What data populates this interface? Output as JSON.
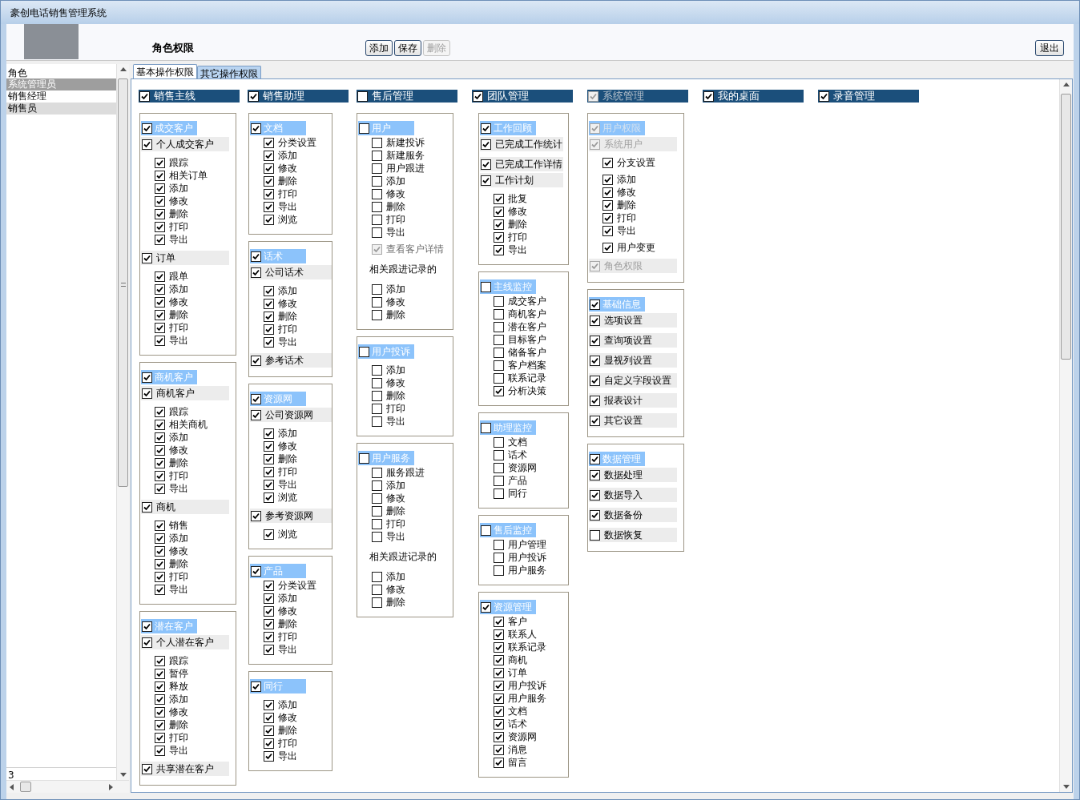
{
  "window": {
    "title": "豪创电话销售管理系统"
  },
  "header": {
    "title": "角色权限",
    "buttons": [
      {
        "label": "添加",
        "disabled": false
      },
      {
        "label": "保存",
        "disabled": false
      },
      {
        "label": "删除",
        "disabled": true
      }
    ],
    "exit_button": "退出"
  },
  "roles": {
    "heading": "角色",
    "items": [
      {
        "label": "系统管理员",
        "selected": true
      },
      {
        "label": "销售经理",
        "selected": false
      },
      {
        "label": "销售员",
        "selected": false
      }
    ],
    "count": "3"
  },
  "tabs": [
    {
      "label": "基本操作权限",
      "selected": true
    },
    {
      "label": "其它操作权限",
      "selected": false
    }
  ],
  "columns": [
    {
      "header": {
        "label": "销售主线",
        "checked": true,
        "disabled": false
      },
      "groups": [
        {
          "blocks": [
            [
              {
                "kind": "title",
                "label": "成交客户",
                "checked": true,
                "disabled": false
              },
              {
                "kind": "section",
                "label": "个人成交客户",
                "checked": true,
                "disabled": false
              }
            ],
            [
              {
                "kind": "option",
                "label": "跟踪",
                "checked": true,
                "disabled": false
              },
              {
                "kind": "option",
                "label": "相关订单",
                "checked": true,
                "disabled": false
              },
              {
                "kind": "option",
                "label": "添加",
                "checked": true,
                "disabled": false
              },
              {
                "kind": "option",
                "label": "修改",
                "checked": true,
                "disabled": false
              },
              {
                "kind": "option",
                "label": "删除",
                "checked": true,
                "disabled": false
              },
              {
                "kind": "option",
                "label": "打印",
                "checked": true,
                "disabled": false
              },
              {
                "kind": "option",
                "label": "导出",
                "checked": true,
                "disabled": false
              }
            ],
            [
              {
                "kind": "section",
                "label": "订单",
                "checked": true,
                "disabled": false
              }
            ],
            [
              {
                "kind": "option",
                "label": "跟单",
                "checked": true,
                "disabled": false
              },
              {
                "kind": "option",
                "label": "添加",
                "checked": true,
                "disabled": false
              },
              {
                "kind": "option",
                "label": "修改",
                "checked": true,
                "disabled": false
              },
              {
                "kind": "option",
                "label": "删除",
                "checked": true,
                "disabled": false
              },
              {
                "kind": "option",
                "label": "打印",
                "checked": true,
                "disabled": false
              },
              {
                "kind": "option",
                "label": "导出",
                "checked": true,
                "disabled": false
              }
            ]
          ]
        },
        {
          "blocks": [
            [
              {
                "kind": "title",
                "label": "商机客户",
                "checked": true,
                "disabled": false
              },
              {
                "kind": "section",
                "label": "商机客户",
                "checked": true,
                "disabled": false
              }
            ],
            [
              {
                "kind": "option",
                "label": "跟踪",
                "checked": true,
                "disabled": false
              },
              {
                "kind": "option",
                "label": "相关商机",
                "checked": true,
                "disabled": false
              },
              {
                "kind": "option",
                "label": "添加",
                "checked": true,
                "disabled": false
              },
              {
                "kind": "option",
                "label": "修改",
                "checked": true,
                "disabled": false
              },
              {
                "kind": "option",
                "label": "删除",
                "checked": true,
                "disabled": false
              },
              {
                "kind": "option",
                "label": "打印",
                "checked": true,
                "disabled": false
              },
              {
                "kind": "option",
                "label": "导出",
                "checked": true,
                "disabled": false
              }
            ],
            [
              {
                "kind": "section",
                "label": "商机",
                "checked": true,
                "disabled": false
              }
            ],
            [
              {
                "kind": "option",
                "label": "销售",
                "checked": true,
                "disabled": false
              },
              {
                "kind": "option",
                "label": "添加",
                "checked": true,
                "disabled": false
              },
              {
                "kind": "option",
                "label": "修改",
                "checked": true,
                "disabled": false
              },
              {
                "kind": "option",
                "label": "删除",
                "checked": true,
                "disabled": false
              },
              {
                "kind": "option",
                "label": "打印",
                "checked": true,
                "disabled": false
              },
              {
                "kind": "option",
                "label": "导出",
                "checked": true,
                "disabled": false
              }
            ]
          ]
        },
        {
          "blocks": [
            [
              {
                "kind": "title",
                "label": "潜在客户",
                "checked": true,
                "disabled": false
              },
              {
                "kind": "section",
                "label": "个人潜在客户",
                "checked": true,
                "disabled": false
              }
            ],
            [
              {
                "kind": "option",
                "label": "跟踪",
                "checked": true,
                "disabled": false
              },
              {
                "kind": "option",
                "label": "暂停",
                "checked": true,
                "disabled": false
              },
              {
                "kind": "option",
                "label": "释放",
                "checked": true,
                "disabled": false
              },
              {
                "kind": "option",
                "label": "添加",
                "checked": true,
                "disabled": false
              },
              {
                "kind": "option",
                "label": "修改",
                "checked": true,
                "disabled": false
              },
              {
                "kind": "option",
                "label": "删除",
                "checked": true,
                "disabled": false
              },
              {
                "kind": "option",
                "label": "打印",
                "checked": true,
                "disabled": false
              },
              {
                "kind": "option",
                "label": "导出",
                "checked": true,
                "disabled": false
              }
            ],
            [
              {
                "kind": "section",
                "label": "共享潜在客户",
                "checked": true,
                "disabled": false
              }
            ]
          ]
        }
      ]
    },
    {
      "header": {
        "label": "销售助理",
        "checked": true,
        "disabled": false
      },
      "groups": [
        {
          "blocks": [
            [
              {
                "kind": "title",
                "label": "文档",
                "checked": true,
                "disabled": false
              },
              {
                "kind": "option",
                "label": "分类设置",
                "checked": true,
                "disabled": false
              },
              {
                "kind": "option",
                "label": "添加",
                "checked": true,
                "disabled": false
              },
              {
                "kind": "option",
                "label": "修改",
                "checked": true,
                "disabled": false
              },
              {
                "kind": "option",
                "label": "删除",
                "checked": true,
                "disabled": false
              },
              {
                "kind": "option",
                "label": "打印",
                "checked": true,
                "disabled": false
              },
              {
                "kind": "option",
                "label": "导出",
                "checked": true,
                "disabled": false
              },
              {
                "kind": "option",
                "label": "浏览",
                "checked": true,
                "disabled": false
              }
            ]
          ]
        },
        {
          "blocks": [
            [
              {
                "kind": "title",
                "label": "话术",
                "checked": true,
                "disabled": false
              },
              {
                "kind": "section",
                "label": "公司话术",
                "checked": true,
                "disabled": false
              }
            ],
            [
              {
                "kind": "option",
                "label": "添加",
                "checked": true,
                "disabled": false
              },
              {
                "kind": "option",
                "label": "修改",
                "checked": true,
                "disabled": false
              },
              {
                "kind": "option",
                "label": "删除",
                "checked": true,
                "disabled": false
              },
              {
                "kind": "option",
                "label": "打印",
                "checked": true,
                "disabled": false
              },
              {
                "kind": "option",
                "label": "导出",
                "checked": true,
                "disabled": false
              }
            ],
            [
              {
                "kind": "section",
                "label": "参考话术",
                "checked": true,
                "disabled": false
              }
            ]
          ]
        },
        {
          "blocks": [
            [
              {
                "kind": "title",
                "label": "资源网",
                "checked": true,
                "disabled": false
              },
              {
                "kind": "section",
                "label": "公司资源网",
                "checked": true,
                "disabled": false
              }
            ],
            [
              {
                "kind": "option",
                "label": "添加",
                "checked": true,
                "disabled": false
              },
              {
                "kind": "option",
                "label": "修改",
                "checked": true,
                "disabled": false
              },
              {
                "kind": "option",
                "label": "删除",
                "checked": true,
                "disabled": false
              },
              {
                "kind": "option",
                "label": "打印",
                "checked": true,
                "disabled": false
              },
              {
                "kind": "option",
                "label": "导出",
                "checked": true,
                "disabled": false
              },
              {
                "kind": "option",
                "label": "浏览",
                "checked": true,
                "disabled": false
              }
            ],
            [
              {
                "kind": "section",
                "label": "参考资源网",
                "checked": true,
                "disabled": false
              }
            ],
            [
              {
                "kind": "option",
                "label": "浏览",
                "checked": true,
                "disabled": false
              }
            ]
          ]
        },
        {
          "blocks": [
            [
              {
                "kind": "title",
                "label": "产品",
                "checked": true,
                "disabled": false
              },
              {
                "kind": "option",
                "label": "分类设置",
                "checked": true,
                "disabled": false
              },
              {
                "kind": "option",
                "label": "添加",
                "checked": true,
                "disabled": false
              },
              {
                "kind": "option",
                "label": "修改",
                "checked": true,
                "disabled": false
              },
              {
                "kind": "option",
                "label": "删除",
                "checked": true,
                "disabled": false
              },
              {
                "kind": "option",
                "label": "打印",
                "checked": true,
                "disabled": false
              },
              {
                "kind": "option",
                "label": "导出",
                "checked": true,
                "disabled": false
              }
            ]
          ]
        },
        {
          "blocks": [
            [
              {
                "kind": "title",
                "label": "同行",
                "checked": true,
                "disabled": false
              }
            ],
            [
              {
                "kind": "option",
                "label": "添加",
                "checked": true,
                "disabled": false
              },
              {
                "kind": "option",
                "label": "修改",
                "checked": true,
                "disabled": false
              },
              {
                "kind": "option",
                "label": "删除",
                "checked": true,
                "disabled": false
              },
              {
                "kind": "option",
                "label": "打印",
                "checked": true,
                "disabled": false
              },
              {
                "kind": "option",
                "label": "导出",
                "checked": true,
                "disabled": false
              }
            ]
          ]
        }
      ]
    },
    {
      "header": {
        "label": "售后管理",
        "checked": false,
        "disabled": false
      },
      "groups": [
        {
          "blocks": [
            [
              {
                "kind": "title",
                "label": "用户",
                "checked": false,
                "disabled": false
              },
              {
                "kind": "option",
                "label": "新建投诉",
                "checked": false,
                "disabled": false
              },
              {
                "kind": "option",
                "label": "新建服务",
                "checked": false,
                "disabled": false
              },
              {
                "kind": "option",
                "label": "用户跟进",
                "checked": false,
                "disabled": false
              },
              {
                "kind": "option",
                "label": "添加",
                "checked": false,
                "disabled": false
              },
              {
                "kind": "option",
                "label": "修改",
                "checked": false,
                "disabled": false
              },
              {
                "kind": "option",
                "label": "删除",
                "checked": false,
                "disabled": false
              },
              {
                "kind": "option",
                "label": "打印",
                "checked": false,
                "disabled": false
              },
              {
                "kind": "option",
                "label": "导出",
                "checked": false,
                "disabled": false
              }
            ],
            [
              {
                "kind": "option",
                "label": "查看客户详情",
                "checked": true,
                "disabled": true
              }
            ],
            [
              {
                "kind": "note",
                "label": "相关跟进记录的"
              }
            ],
            [
              {
                "kind": "option",
                "label": "添加",
                "checked": false,
                "disabled": false
              },
              {
                "kind": "option",
                "label": "修改",
                "checked": false,
                "disabled": false
              },
              {
                "kind": "option",
                "label": "删除",
                "checked": false,
                "disabled": false
              }
            ]
          ]
        },
        {
          "blocks": [
            [
              {
                "kind": "title",
                "label": "用户投诉",
                "checked": false,
                "disabled": false
              }
            ],
            [
              {
                "kind": "option",
                "label": "添加",
                "checked": false,
                "disabled": false
              },
              {
                "kind": "option",
                "label": "修改",
                "checked": false,
                "disabled": false
              },
              {
                "kind": "option",
                "label": "删除",
                "checked": false,
                "disabled": false
              },
              {
                "kind": "option",
                "label": "打印",
                "checked": false,
                "disabled": false
              },
              {
                "kind": "option",
                "label": "导出",
                "checked": false,
                "disabled": false
              }
            ]
          ]
        },
        {
          "blocks": [
            [
              {
                "kind": "title",
                "label": "用户服务",
                "checked": false,
                "disabled": false
              },
              {
                "kind": "option",
                "label": "服务跟进",
                "checked": false,
                "disabled": false
              },
              {
                "kind": "option",
                "label": "添加",
                "checked": false,
                "disabled": false
              },
              {
                "kind": "option",
                "label": "修改",
                "checked": false,
                "disabled": false
              },
              {
                "kind": "option",
                "label": "删除",
                "checked": false,
                "disabled": false
              },
              {
                "kind": "option",
                "label": "打印",
                "checked": false,
                "disabled": false
              },
              {
                "kind": "option",
                "label": "导出",
                "checked": false,
                "disabled": false
              }
            ],
            [
              {
                "kind": "note",
                "label": "相关跟进记录的"
              }
            ],
            [
              {
                "kind": "option",
                "label": "添加",
                "checked": false,
                "disabled": false
              },
              {
                "kind": "option",
                "label": "修改",
                "checked": false,
                "disabled": false
              },
              {
                "kind": "option",
                "label": "删除",
                "checked": false,
                "disabled": false
              }
            ]
          ]
        }
      ]
    },
    {
      "header": {
        "label": "团队管理",
        "checked": true,
        "disabled": false
      },
      "groups": [
        {
          "blocks": [
            [
              {
                "kind": "title",
                "label": "工作回顾",
                "checked": true,
                "disabled": false
              },
              {
                "kind": "section",
                "label": "已完成工作统计",
                "checked": true,
                "disabled": false
              }
            ],
            [
              {
                "kind": "section",
                "label": "已完成工作详情",
                "checked": true,
                "disabled": false
              },
              {
                "kind": "section",
                "label": "工作计划",
                "checked": true,
                "disabled": false
              }
            ],
            [
              {
                "kind": "option",
                "label": "批复",
                "checked": true,
                "disabled": false
              },
              {
                "kind": "option",
                "label": "修改",
                "checked": true,
                "disabled": false
              },
              {
                "kind": "option",
                "label": "删除",
                "checked": true,
                "disabled": false
              },
              {
                "kind": "option",
                "label": "打印",
                "checked": true,
                "disabled": false
              },
              {
                "kind": "option",
                "label": "导出",
                "checked": true,
                "disabled": false
              }
            ]
          ]
        },
        {
          "blocks": [
            [
              {
                "kind": "title",
                "label": "主线监控",
                "checked": false,
                "disabled": false
              },
              {
                "kind": "option",
                "label": "成交客户",
                "checked": false,
                "disabled": false
              },
              {
                "kind": "option",
                "label": "商机客户",
                "checked": false,
                "disabled": false
              },
              {
                "kind": "option",
                "label": "潜在客户",
                "checked": false,
                "disabled": false
              },
              {
                "kind": "option",
                "label": "目标客户",
                "checked": false,
                "disabled": false
              },
              {
                "kind": "option",
                "label": "储备客户",
                "checked": false,
                "disabled": false
              },
              {
                "kind": "option",
                "label": "客户档案",
                "checked": false,
                "disabled": false
              },
              {
                "kind": "option",
                "label": "联系记录",
                "checked": false,
                "disabled": false
              },
              {
                "kind": "option",
                "label": "分析决策",
                "checked": true,
                "disabled": false
              }
            ]
          ]
        },
        {
          "blocks": [
            [
              {
                "kind": "title",
                "label": "助理监控",
                "checked": false,
                "disabled": false
              },
              {
                "kind": "option",
                "label": "文档",
                "checked": false,
                "disabled": false
              },
              {
                "kind": "option",
                "label": "话术",
                "checked": false,
                "disabled": false
              },
              {
                "kind": "option",
                "label": "资源网",
                "checked": false,
                "disabled": false
              },
              {
                "kind": "option",
                "label": "产品",
                "checked": false,
                "disabled": false
              },
              {
                "kind": "option",
                "label": "同行",
                "checked": false,
                "disabled": false
              }
            ]
          ]
        },
        {
          "blocks": [
            [
              {
                "kind": "title",
                "label": "售后监控",
                "checked": false,
                "disabled": false
              },
              {
                "kind": "option",
                "label": "用户管理",
                "checked": false,
                "disabled": false
              },
              {
                "kind": "option",
                "label": "用户投诉",
                "checked": false,
                "disabled": false
              },
              {
                "kind": "option",
                "label": "用户服务",
                "checked": false,
                "disabled": false
              }
            ]
          ]
        },
        {
          "blocks": [
            [
              {
                "kind": "title",
                "label": "资源管理",
                "checked": true,
                "disabled": false
              },
              {
                "kind": "option",
                "label": "客户",
                "checked": true,
                "disabled": false
              },
              {
                "kind": "option",
                "label": "联系人",
                "checked": true,
                "disabled": false
              },
              {
                "kind": "option",
                "label": "联系记录",
                "checked": true,
                "disabled": false
              },
              {
                "kind": "option",
                "label": "商机",
                "checked": true,
                "disabled": false
              },
              {
                "kind": "option",
                "label": "订单",
                "checked": true,
                "disabled": false
              },
              {
                "kind": "option",
                "label": "用户投诉",
                "checked": true,
                "disabled": false
              },
              {
                "kind": "option",
                "label": "用户服务",
                "checked": true,
                "disabled": false
              },
              {
                "kind": "option",
                "label": "文档",
                "checked": true,
                "disabled": false
              },
              {
                "kind": "option",
                "label": "话术",
                "checked": true,
                "disabled": false
              },
              {
                "kind": "option",
                "label": "资源网",
                "checked": true,
                "disabled": false
              },
              {
                "kind": "option",
                "label": "消息",
                "checked": true,
                "disabled": false
              },
              {
                "kind": "option",
                "label": "留言",
                "checked": true,
                "disabled": false
              }
            ]
          ]
        }
      ]
    },
    {
      "header": {
        "label": "系统管理",
        "checked": true,
        "disabled": true
      },
      "groups": [
        {
          "blocks": [
            [
              {
                "kind": "title",
                "label": "用户权限",
                "checked": true,
                "disabled": true
              },
              {
                "kind": "section",
                "label": "系统用户",
                "checked": true,
                "disabled": true
              }
            ],
            [
              {
                "kind": "option",
                "label": "分支设置",
                "checked": true,
                "disabled": false
              }
            ],
            [
              {
                "kind": "option",
                "label": "添加",
                "checked": true,
                "disabled": false
              },
              {
                "kind": "option",
                "label": "修改",
                "checked": true,
                "disabled": false
              },
              {
                "kind": "option",
                "label": "删除",
                "checked": true,
                "disabled": false
              },
              {
                "kind": "option",
                "label": "打印",
                "checked": true,
                "disabled": false
              },
              {
                "kind": "option",
                "label": "导出",
                "checked": true,
                "disabled": false
              }
            ],
            [
              {
                "kind": "option",
                "label": "用户变更",
                "checked": true,
                "disabled": false
              }
            ],
            [
              {
                "kind": "section",
                "label": "角色权限",
                "checked": true,
                "disabled": true
              }
            ]
          ]
        },
        {
          "blocks": [
            [
              {
                "kind": "title",
                "label": "基础信息",
                "checked": true,
                "disabled": false
              },
              {
                "kind": "section",
                "label": "选项设置",
                "checked": true,
                "disabled": false
              }
            ],
            [
              {
                "kind": "section",
                "label": "查询项设置",
                "checked": true,
                "disabled": false
              }
            ],
            [
              {
                "kind": "section",
                "label": "显视列设置",
                "checked": true,
                "disabled": false
              }
            ],
            [
              {
                "kind": "section",
                "label": "自定义字段设置",
                "checked": true,
                "disabled": false
              }
            ],
            [
              {
                "kind": "section",
                "label": "报表设计",
                "checked": true,
                "disabled": false
              }
            ],
            [
              {
                "kind": "section",
                "label": "其它设置",
                "checked": true,
                "disabled": false
              }
            ]
          ]
        },
        {
          "blocks": [
            [
              {
                "kind": "title",
                "label": "数据管理",
                "checked": true,
                "disabled": false
              },
              {
                "kind": "section",
                "label": "数据处理",
                "checked": true,
                "disabled": false
              }
            ],
            [
              {
                "kind": "section",
                "label": "数据导入",
                "checked": true,
                "disabled": false
              }
            ],
            [
              {
                "kind": "section",
                "label": "数据备份",
                "checked": true,
                "disabled": false
              }
            ],
            [
              {
                "kind": "section",
                "label": "数据恢复",
                "checked": false,
                "disabled": false
              }
            ]
          ]
        }
      ]
    },
    {
      "header": {
        "label": "我的桌面",
        "checked": true,
        "disabled": false
      }
    },
    {
      "header": {
        "label": "录音管理",
        "checked": true,
        "disabled": false
      }
    }
  ]
}
